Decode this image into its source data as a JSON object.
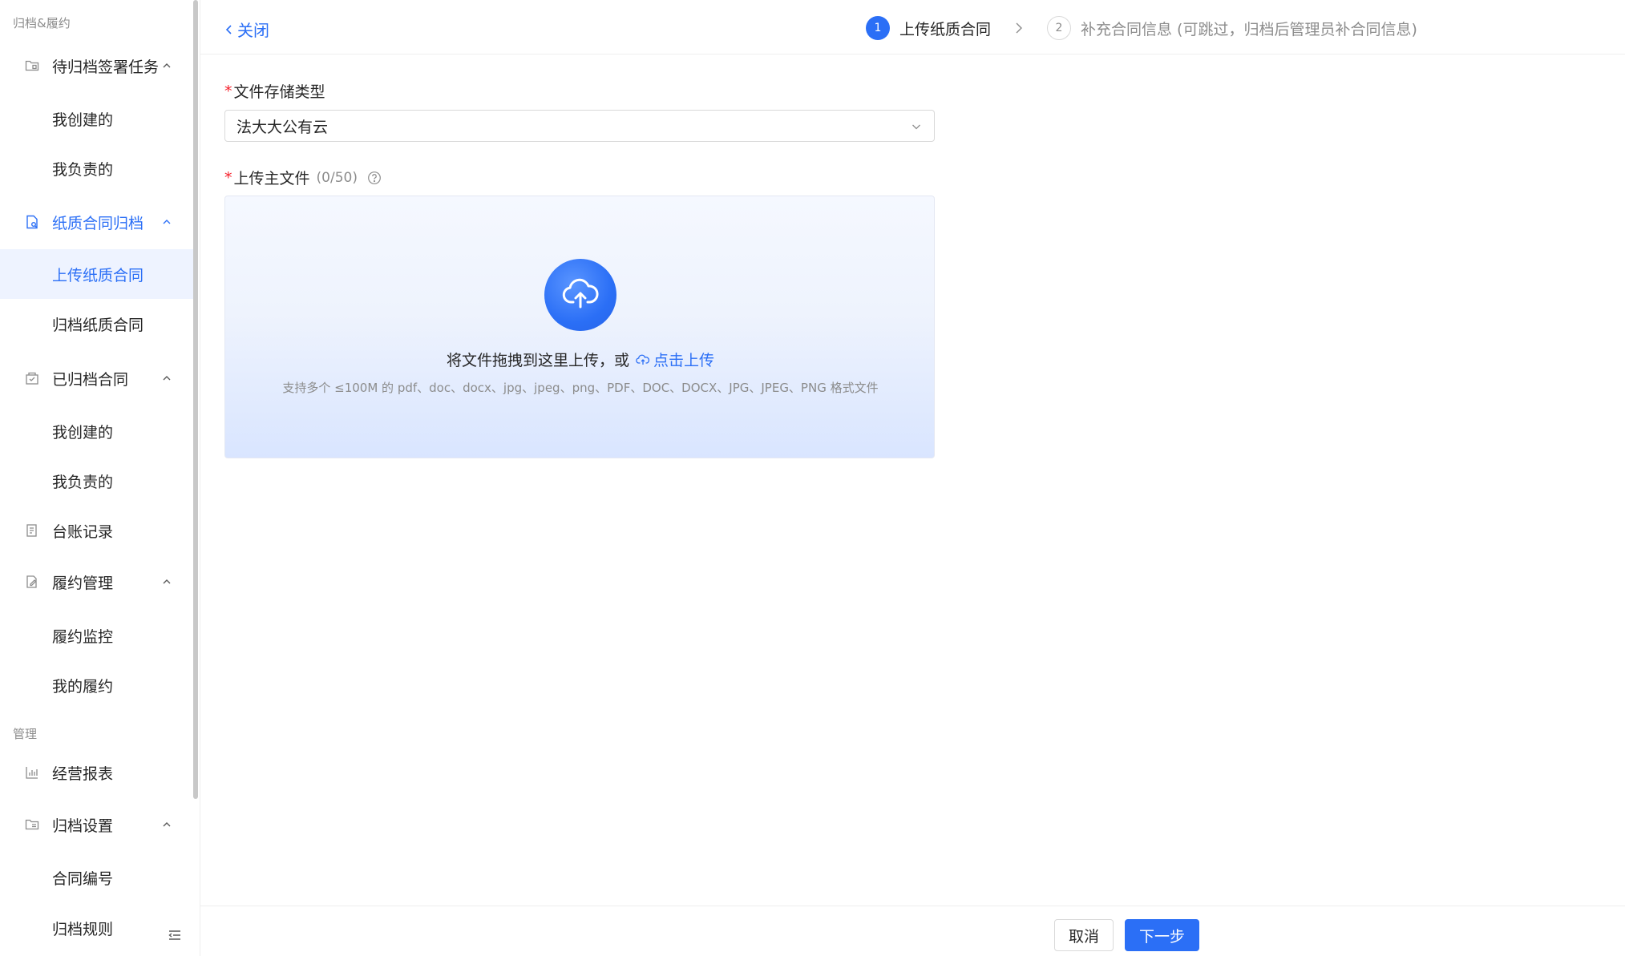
{
  "colors": {
    "accent": "#2b6ff6",
    "required": "#f5222d",
    "muted": "#8c8c8c"
  },
  "sidebar": {
    "section_archive": "归档&履约",
    "section_manage": "管理",
    "groups": {
      "pending": {
        "label": "待归档签署任务",
        "icon": "folder-doc-icon"
      },
      "paper": {
        "label": "纸质合同归档",
        "icon": "file-search-icon"
      },
      "archived": {
        "label": "已归档合同",
        "icon": "archive-box-icon"
      },
      "ledger": {
        "label": "台账记录",
        "icon": "ledger-icon"
      },
      "perform": {
        "label": "履约管理",
        "icon": "edit-doc-icon"
      },
      "report": {
        "label": "经营报表",
        "icon": "bar-chart-icon"
      },
      "settings": {
        "label": "归档设置",
        "icon": "folder-settings-icon"
      }
    },
    "items": {
      "pending_created": "我创建的",
      "pending_owned": "我负责的",
      "paper_upload": "上传纸质合同",
      "paper_archive": "归档纸质合同",
      "archived_created": "我创建的",
      "archived_owned": "我负责的",
      "perform_monitor": "履约监控",
      "perform_mine": "我的履约",
      "settings_number": "合同编号",
      "settings_rules": "归档规则"
    }
  },
  "topbar": {
    "close_label": "关闭",
    "steps": [
      {
        "num": "1",
        "title": "上传纸质合同"
      },
      {
        "num": "2",
        "title": "补充合同信息 (可跳过，归档后管理员补合同信息)"
      }
    ]
  },
  "form": {
    "storage_label": "文件存储类型",
    "storage_value": "法大大公有云",
    "upload_label": "上传主文件",
    "upload_count": "(0/50)",
    "drop_text": "将文件拖拽到这里上传，或",
    "click_upload": "点击上传",
    "drop_hint": "支持多个 ≤100M 的 pdf、doc、docx、jpg、jpeg、png、PDF、DOC、DOCX、JPG、JPEG、PNG 格式文件"
  },
  "footer": {
    "cancel_label": "取消",
    "next_label": "下一步"
  }
}
